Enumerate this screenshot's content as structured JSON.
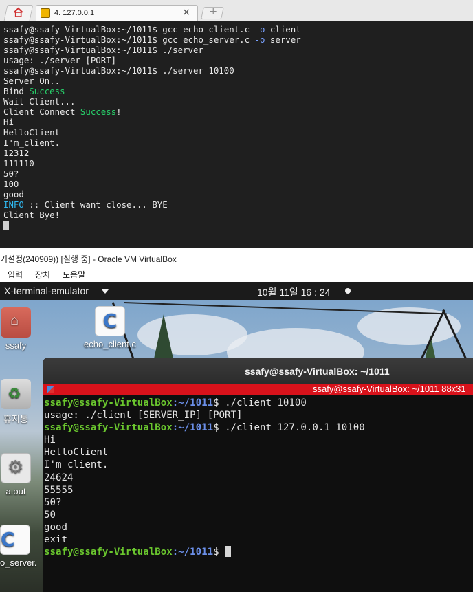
{
  "tabs": {
    "home_icon": "home-icon",
    "session_label": "4. 127.0.0.1",
    "close_glyph": "×",
    "new_tab_glyph": "+"
  },
  "server_terminal": {
    "lines": [
      {
        "user": "ssafy@ssafy-VirtualBox:~/1011$ ",
        "cmd1": "gcc echo_client.c ",
        "flag": "-o",
        "cmd2": " client"
      },
      {
        "user": "ssafy@ssafy-VirtualBox:~/1011$ ",
        "cmd1": "gcc echo_server.c ",
        "flag": "-o",
        "cmd2": " server"
      },
      {
        "text": "ssafy@ssafy-VirtualBox:~/1011$ ./server"
      },
      {
        "text": "usage: ./server [PORT]"
      },
      {
        "text": "ssafy@ssafy-VirtualBox:~/1011$ ./server 10100"
      },
      {
        "text": "Server On.."
      },
      {
        "pre": "Bind ",
        "hl": "Success",
        "post": ""
      },
      {
        "text": "Wait Client..."
      },
      {
        "pre": "Client Connect ",
        "hl": "Success",
        "post": "!"
      },
      {
        "text": "Hi"
      },
      {
        "text": "HelloClient"
      },
      {
        "text": "I'm_client."
      },
      {
        "text": "12312"
      },
      {
        "text": "111110"
      },
      {
        "text": "50?"
      },
      {
        "text": "100"
      },
      {
        "text": "good"
      },
      {
        "info": "INFO",
        "post": " :: Client want close... BYE"
      },
      {
        "text": "Client Bye!"
      }
    ]
  },
  "vbox": {
    "title": "기설정(240909)) [실행 중] - Oracle VM VirtualBox",
    "menu": [
      "입력",
      "장치",
      "도움말"
    ]
  },
  "ubuntu_bar": {
    "app": "X-terminal-emulator",
    "clock": "10월 11일  16 : 24"
  },
  "desktop_icons": [
    {
      "label": "ssafy"
    },
    {
      "label": "echo_client.c"
    },
    {
      "label": "휴지통"
    },
    {
      "label": "a.out"
    },
    {
      "label": "o_server."
    }
  ],
  "client_window": {
    "title": "ssafy@ssafy-VirtualBox: ~/1011",
    "subtitle": "ssafy@ssafy-VirtualBox: ~/1011 88x31",
    "prompt_user": "ssafy@ssafy-VirtualBox",
    "prompt_dir": ":~/1011",
    "prompt_sign": "$ ",
    "lines": [
      {
        "prompt": true,
        "cmd": "./client 10100"
      },
      {
        "text": "usage: ./client [SERVER_IP] [PORT]"
      },
      {
        "prompt": true,
        "cmd": "./client 127.0.0.1 10100"
      },
      {
        "text": "Hi"
      },
      {
        "text": "HelloClient"
      },
      {
        "text": "I'm_client."
      },
      {
        "text": "24624"
      },
      {
        "text": "55555"
      },
      {
        "text": "50?"
      },
      {
        "text": "50"
      },
      {
        "text": "good"
      },
      {
        "text": "exit"
      },
      {
        "prompt": true,
        "cmd": ""
      }
    ]
  },
  "colors": {
    "prompt_user": "#6ac62e",
    "prompt_dir": "#6b8fe8",
    "success": "#27d06a",
    "info": "#2fb8f0",
    "title_red": "#d8121b"
  }
}
